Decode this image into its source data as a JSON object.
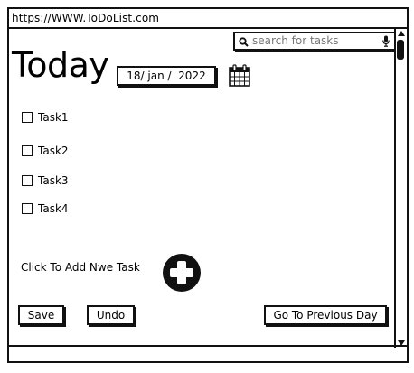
{
  "browser": {
    "url": "https://WWW.ToDoList.com"
  },
  "search": {
    "placeholder": "search for tasks",
    "icon": "search-icon",
    "mic_icon": "microphone-icon"
  },
  "header": {
    "title": "Today",
    "date": "18/ jan /  2022",
    "calendar_icon": "calendar-icon"
  },
  "tasks": [
    {
      "label": "Task1",
      "checked": false
    },
    {
      "label": "Task2",
      "checked": false
    },
    {
      "label": "Task3",
      "checked": false
    },
    {
      "label": "Task4",
      "checked": false
    }
  ],
  "add_task": {
    "label": "Click To Add Nwe Task",
    "icon": "plus-circle-icon"
  },
  "actions": {
    "save_label": "Save",
    "undo_label": "Undo",
    "previous_day_label": "Go To Previous Day"
  }
}
